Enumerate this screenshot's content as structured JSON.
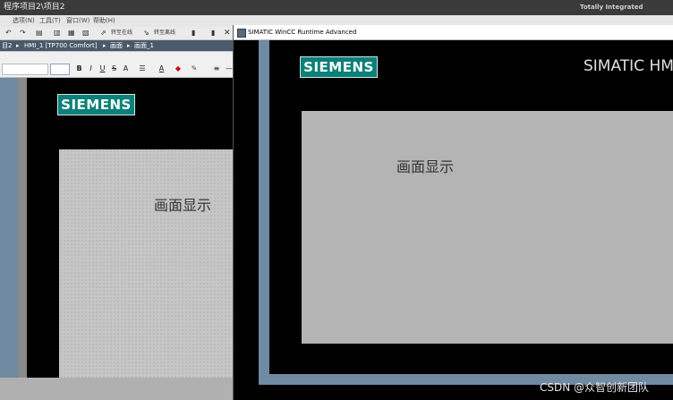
{
  "tia": {
    "title": "程序项目2\\项目2",
    "brand": "Totally Integrated Automati",
    "menu": [
      "选项(N)",
      "工具(T)",
      "窗口(W)",
      "帮助(H)"
    ],
    "toolbar": {
      "go_online": "转至在线",
      "go_offline": "转至离线",
      "close": "✕"
    },
    "breadcrumb": [
      "目2",
      "HMI_1 [TP700 Comfort]",
      "画面",
      "画面_1"
    ]
  },
  "format_bar": {
    "bold": "B",
    "italic": "I",
    "underline": "U",
    "strike": "S",
    "superscript": "A",
    "font_color": "A"
  },
  "editor": {
    "logo": "SIEMENS",
    "text": "画面显示"
  },
  "runtime": {
    "window_title": "SIMATIC WinCC Runtime Advanced",
    "logo": "SIEMENS",
    "product": "SIMATIC HMI",
    "text": "画面显示"
  },
  "watermark": "CSDN @众智创新团队",
  "colors": {
    "siemens_teal": "#0b8079",
    "frame_blue": "#6f8aa1",
    "screen_gray": "#b4b4b4"
  }
}
